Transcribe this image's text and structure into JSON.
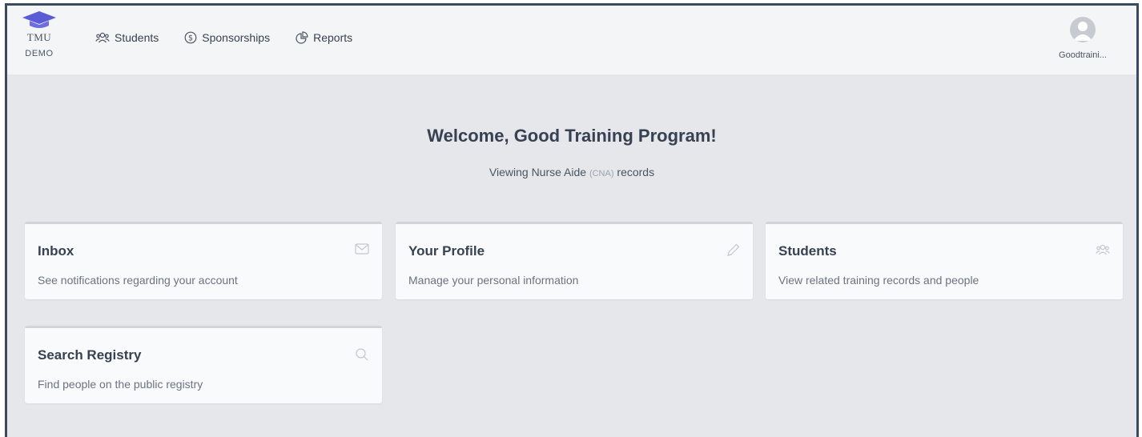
{
  "brand": {
    "line1": "TMU",
    "line2": "DEMO"
  },
  "nav": [
    {
      "label": "Students",
      "icon": "users-icon"
    },
    {
      "label": "Sponsorships",
      "icon": "dollar-circle-icon"
    },
    {
      "label": "Reports",
      "icon": "pie-chart-icon"
    }
  ],
  "user": {
    "name": "Goodtraini..."
  },
  "welcome": {
    "title": "Welcome, Good Training Program!"
  },
  "subtitle": {
    "prefix": "Viewing Nurse Aide ",
    "code": "(CNA)",
    "suffix": " records"
  },
  "cards": [
    {
      "title": "Inbox",
      "description": "See notifications regarding your account",
      "icon": "envelope-icon"
    },
    {
      "title": "Your Profile",
      "description": "Manage your personal information",
      "icon": "pencil-icon"
    },
    {
      "title": "Students",
      "description": "View related training records and people",
      "icon": "users-icon"
    },
    {
      "title": "Search Registry",
      "description": "Find people on the public registry",
      "icon": "search-icon"
    }
  ],
  "colors": {
    "accent": "#5b5bd6",
    "background": "#e5e7eb",
    "topbar": "#f4f5f7",
    "card": "#f9fafb"
  }
}
